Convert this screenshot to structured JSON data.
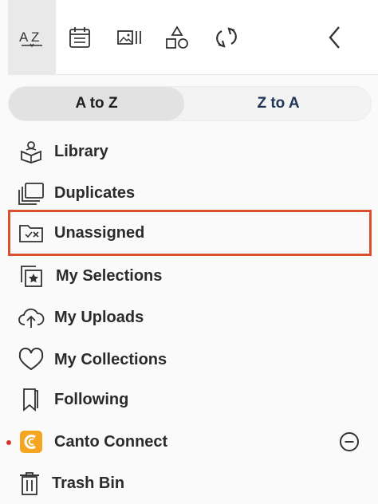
{
  "toolbar": {
    "tools": [
      {
        "name": "sort-az-icon",
        "label": "A Z"
      },
      {
        "name": "calendar-icon"
      },
      {
        "name": "image-gallery-icon"
      },
      {
        "name": "shapes-icon"
      },
      {
        "name": "sync-icon"
      },
      {
        "name": "chevron-left-icon"
      }
    ]
  },
  "sort": {
    "a_to_z": "A to Z",
    "z_to_a": "Z to A",
    "selected": "A to Z"
  },
  "sidebar": {
    "items": [
      {
        "label": "Library",
        "icon": "library-icon"
      },
      {
        "label": "Duplicates",
        "icon": "duplicates-icon"
      },
      {
        "label": "Unassigned",
        "icon": "unassigned-folder-icon",
        "highlighted": true
      },
      {
        "label": "My Selections",
        "icon": "selections-star-icon"
      },
      {
        "label": "My Uploads",
        "icon": "cloud-upload-icon"
      },
      {
        "label": "My Collections",
        "icon": "heart-icon"
      },
      {
        "label": "Following",
        "icon": "bookmark-icon"
      },
      {
        "label": "Canto Connect",
        "icon": "canto-connect-icon",
        "notification": true
      },
      {
        "label": "Trash Bin",
        "icon": "trash-icon"
      }
    ]
  },
  "colors": {
    "highlight_border": "#d9502e",
    "notification_dot": "#d9352e",
    "canto_orange": "#f4a623",
    "z_to_a_text": "#1d3557"
  }
}
